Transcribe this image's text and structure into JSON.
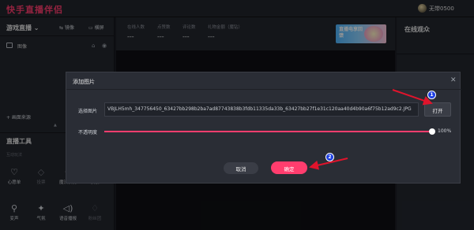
{
  "app": {
    "title": "快手直播伴侣",
    "username": "无带0500"
  },
  "left_panel": {
    "title": "游戏直播",
    "mirror_label": "镜像",
    "landscape_label": "横屏",
    "source_label": "图像",
    "add_source": "+ 画面来源",
    "tools_title": "直播工具",
    "subsection": "互动玩法",
    "tools": [
      {
        "label": "心愿单",
        "icon": "heart-list-icon"
      },
      {
        "label": "投票",
        "icon": "vote-icon"
      },
      {
        "label": "魔法表情",
        "icon": "magic-face-icon"
      },
      {
        "label": "模板",
        "icon": "template-icon"
      },
      {
        "label": "变声",
        "icon": "voice-change-icon"
      },
      {
        "label": "气氛",
        "icon": "atmosphere-icon"
      },
      {
        "label": "语音播报",
        "icon": "voice-broadcast-icon"
      },
      {
        "label": "粉丝团",
        "icon": "fan-club-icon"
      }
    ]
  },
  "stats": [
    {
      "label": "在线人数",
      "value": "---"
    },
    {
      "label": "点赞数",
      "value": "---"
    },
    {
      "label": "评论数",
      "value": "---"
    },
    {
      "label": "礼物金额（魔钻）",
      "value": "---"
    }
  ],
  "banner": {
    "text": "直播电享回馈"
  },
  "right_panel": {
    "title": "在线观众"
  },
  "dialog": {
    "title": "添加图片",
    "picture_label": "选择图片",
    "path_value": "VBJLH5mh_347756450_63427bb298b2ba7ad87743838b3fdb11335da33b_63427bb27f1e31c120aa40d4b90a6f75b12ad9c2.JPG",
    "open_button": "打开",
    "opacity_label": "不透明度",
    "opacity_value": "100%",
    "cancel_button": "取消",
    "ok_button": "确定"
  },
  "annotations": {
    "badge1": "1",
    "badge2": "2"
  },
  "colors": {
    "accent": "#ff3d6e",
    "annotation_badge": "#1e3fe0",
    "annotation_arrow": "#e0142c"
  }
}
